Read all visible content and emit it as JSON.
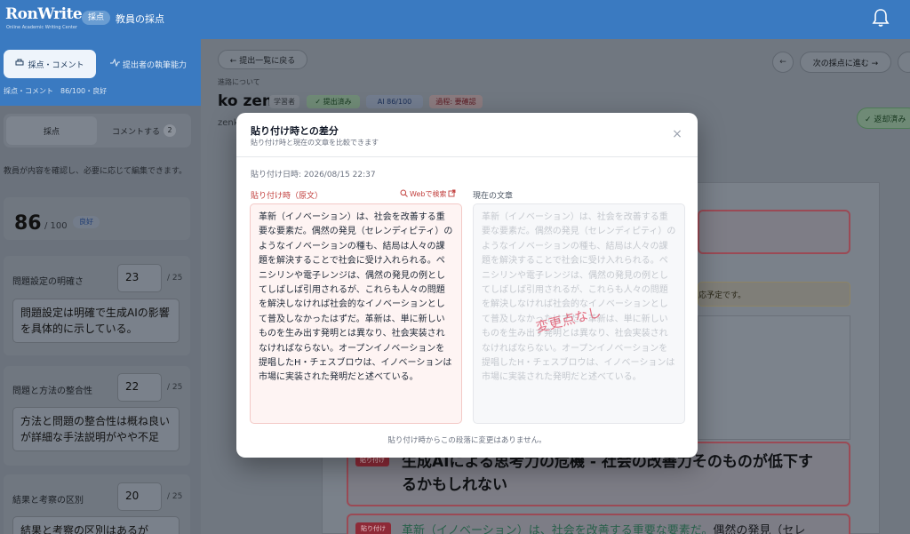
{
  "app": {
    "logo": "RonWrite",
    "logo_sub": "Online Academic Writing Center",
    "header_badge": "採点",
    "header_title": "教員の採点"
  },
  "sidebar": {
    "tabs": [
      "採点・コメント",
      "提出者の執筆能力"
    ],
    "breadcrumb": "採点・コメント　86/100・良好",
    "segments": [
      "採点",
      "コメントする"
    ],
    "comment_count": "2",
    "note": "教員が内容を確認し、必要に応じて編集できます。",
    "score": "86",
    "score_max": "/ 100",
    "score_badge": "良好",
    "criteria": [
      {
        "label": "問題設定の明確さ",
        "score": "23",
        "max": "/ 25",
        "comment": "問題設定は明確で生成AIの影響を具体的に示している。"
      },
      {
        "label": "問題と方法の整合性",
        "score": "22",
        "max": "/ 25",
        "comment": "方法と問題の整合性は概ね良いが詳細な手法説明がやや不足"
      },
      {
        "label": "結果と考察の区別",
        "score": "20",
        "max": "/ 25",
        "comment": "結果と考察の区別はあるが"
      }
    ]
  },
  "main": {
    "back_label": "← 提出一覧に戻る",
    "page_label": "進路について",
    "student_name": "ko zen",
    "chips": [
      "学習者",
      "✓ 提出済み",
      "AI 86/100",
      "過程: 要確認"
    ],
    "sub_name": "zenk",
    "prev_label": "←",
    "next_label": "次の採点に進む →",
    "done_label": "✓ 返却済み",
    "warn_text": "応予定です。",
    "heading_tag": "貼り付け",
    "heading_text": "生成AIによる思考力の危機 - 社会の改善力そのものが低下するかもしれない",
    "para_tag": "貼り付け",
    "para_highlight": "革新（イノベーション）は、社会を改善する重要な要素だ。",
    "para_rest": "偶然の発見（セレ"
  },
  "modal": {
    "title": "貼り付け時との差分",
    "subtitle": "貼り付け時と現在の文章を比較できます",
    "close": "×",
    "date": "貼り付け日時: 2026/08/15 22:37",
    "left_label": "貼り付け時（原文）",
    "web_search": "Webで検索",
    "right_label": "現在の文章",
    "original_text": "革新（イノベーション）は、社会を改善する重要な要素だ。偶然の発見（セレンディピティ）のようなイノベーションの種も、結局は人々の課題を解決することで社会に受け入れられる。ペニシリンや電子レンジは、偶然の発見の例としてしばしば引用されるが、これらも人々の問題を解決しなければ社会的なイノベーションとして普及しなかったはずだ。革新は、単に新しいものを生み出す発明とは異なり、社会実装されなければならない。オープンイノベーションを提唱したH・チェスブロウは、イノベーションは市場に実装された発明だと述べている。",
    "current_text": "革新（イノベーション）は、社会を改善する重要な要素だ。偶然の発見（セレンディピティ）のようなイノベーションの種も、結局は人々の課題を解決することで社会に受け入れられる。ペニシリンや電子レンジは、偶然の発見の例としてしばしば引用されるが、これらも人々の問題を解決しなければ社会的なイノベーションとして普及しなかったはずだ。革新は、単に新しいものを生み出す発明とは異なり、社会実装されなければならない。オープンイノベーションを提唱したH・チェスブロウは、イノベーションは市場に実装された発明だと述べている。",
    "stamp": "変更点なし",
    "footer": "貼り付け時からこの段落に変更はありません。"
  },
  "colors": {
    "header": "#3a7ac1",
    "accent_red": "#c2413f",
    "stamp": "#e05a70"
  },
  "icons": [
    "bell-icon",
    "print-icon",
    "activity-icon",
    "search-icon",
    "external-link-icon",
    "close-icon",
    "check-icon",
    "arrow-left-icon",
    "arrow-right-icon"
  ]
}
